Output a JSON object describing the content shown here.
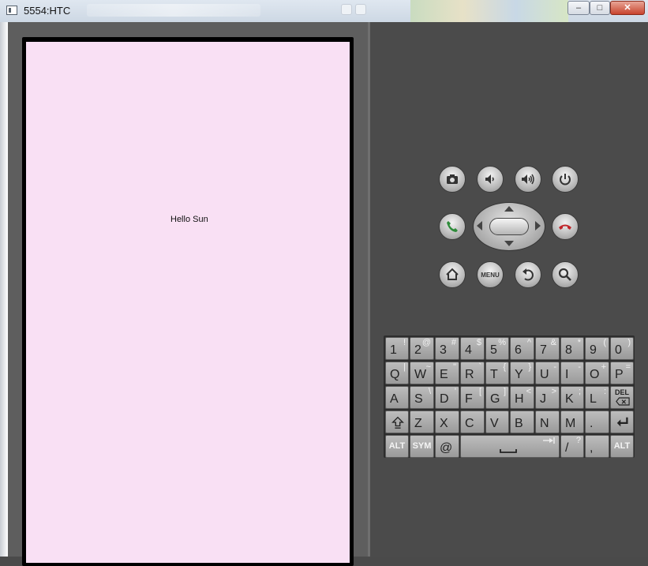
{
  "window": {
    "title": "5554:HTC",
    "minimize_label": "‒",
    "maximize_label": "□",
    "close_label": "✕"
  },
  "screen": {
    "hello_text": "Hello Sun"
  },
  "controls": {
    "camera": "camera-icon",
    "volume_down": "volume-down-icon",
    "volume_up": "volume-up-icon",
    "power": "power-icon",
    "call": "call-icon",
    "end_call": "end-call-icon",
    "home": "home-icon",
    "menu_label": "MENU",
    "back": "back-icon",
    "search": "search-icon",
    "colors": {
      "call": "#2e8b3a",
      "end_call": "#c0262b"
    }
  },
  "keyboard": {
    "row1": [
      {
        "p": "1",
        "s": "!"
      },
      {
        "p": "2",
        "s": "@"
      },
      {
        "p": "3",
        "s": "#"
      },
      {
        "p": "4",
        "s": "$"
      },
      {
        "p": "5",
        "s": "%"
      },
      {
        "p": "6",
        "s": "^"
      },
      {
        "p": "7",
        "s": "&"
      },
      {
        "p": "8",
        "s": "*"
      },
      {
        "p": "9",
        "s": "("
      },
      {
        "p": "0",
        "s": ")"
      }
    ],
    "row2": [
      {
        "p": "Q",
        "s": "|"
      },
      {
        "p": "W",
        "s": "~"
      },
      {
        "p": "E",
        "s": "\""
      },
      {
        "p": "R",
        "s": "`"
      },
      {
        "p": "T",
        "s": "{"
      },
      {
        "p": "Y",
        "s": "}"
      },
      {
        "p": "U",
        "s": "-"
      },
      {
        "p": "I",
        "s": "-"
      },
      {
        "p": "O",
        "s": "+"
      },
      {
        "p": "P",
        "s": "="
      }
    ],
    "row3": [
      {
        "p": "A",
        "s": ""
      },
      {
        "p": "S",
        "s": "\\"
      },
      {
        "p": "D",
        "s": "'"
      },
      {
        "p": "F",
        "s": "["
      },
      {
        "p": "G",
        "s": "]"
      },
      {
        "p": "H",
        "s": "<"
      },
      {
        "p": "J",
        "s": ">"
      },
      {
        "p": "K",
        "s": ";"
      },
      {
        "p": "L",
        "s": ":"
      }
    ],
    "del_label": "DEL",
    "shift_icon": "shift-icon",
    "row4": [
      {
        "p": "Z",
        "s": ""
      },
      {
        "p": "X",
        "s": ""
      },
      {
        "p": "C",
        "s": ""
      },
      {
        "p": "V",
        "s": ""
      },
      {
        "p": "B",
        "s": ""
      },
      {
        "p": "N",
        "s": ""
      },
      {
        "p": "M",
        "s": ""
      },
      {
        "p": ".",
        "s": ""
      }
    ],
    "enter_icon": "enter-icon",
    "alt_label": "ALT",
    "sym_label": "SYM",
    "at_label": "@",
    "space_icon": "space-icon",
    "slash": {
      "p": "/",
      "s": "?"
    },
    "comma": {
      "p": ",",
      "s": ""
    },
    "alt_right_label": "ALT"
  }
}
